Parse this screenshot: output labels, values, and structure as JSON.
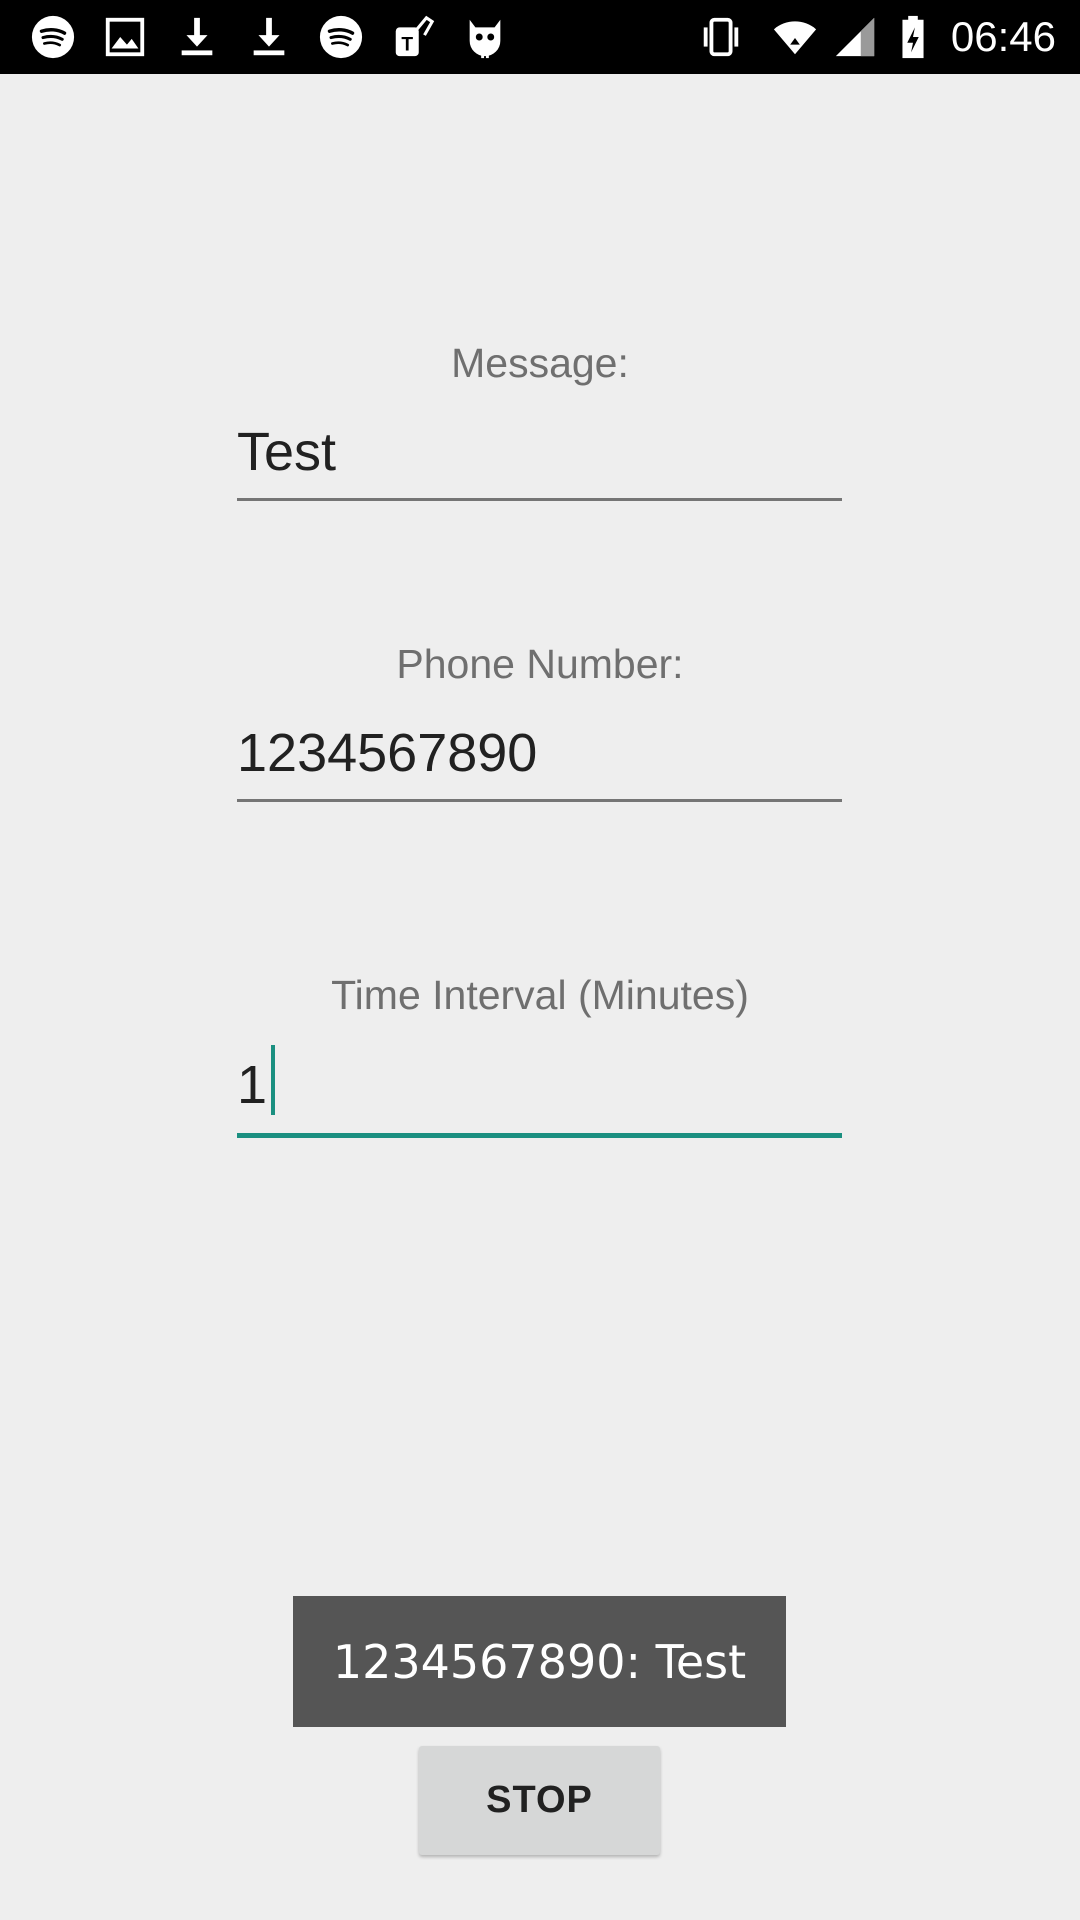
{
  "status_bar": {
    "time": "06:46",
    "left_icons": [
      "spotify-icon",
      "image-icon",
      "download-icon",
      "download-icon",
      "spotify-icon",
      "tmobile-icon",
      "cyanogen-icon"
    ],
    "right_icons": [
      "vibrate-icon",
      "wifi-icon",
      "cell-signal-icon",
      "battery-charging-icon"
    ]
  },
  "form": {
    "message": {
      "label": "Message:",
      "value": "Test"
    },
    "phone": {
      "label": "Phone Number:",
      "value": "1234567890"
    },
    "interval": {
      "label": "Time Interval (Minutes)",
      "value": "1"
    }
  },
  "toast": {
    "text": "1234567890: Test"
  },
  "actions": {
    "stop_label": "STOP"
  },
  "colors": {
    "accent": "#1a8f80",
    "background": "#eeeeee",
    "toast_bg": "#555555",
    "button_bg": "#d6d7d7"
  }
}
